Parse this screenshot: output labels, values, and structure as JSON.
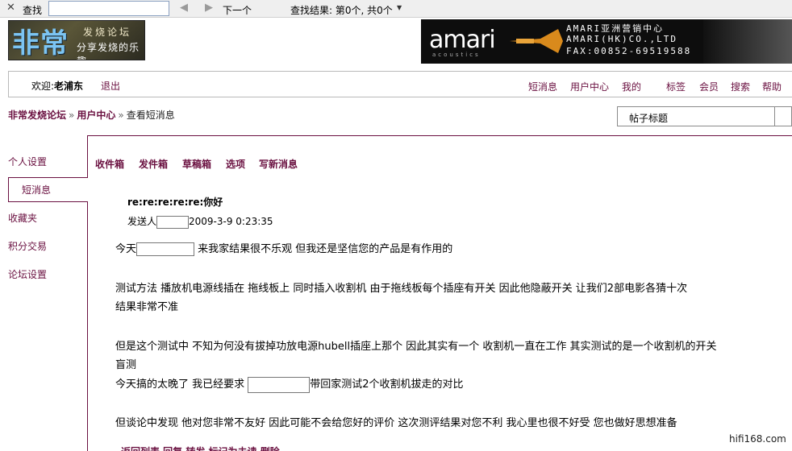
{
  "findbar": {
    "close_icon": "close-icon",
    "label": "查找",
    "input_value": "",
    "prev_icon": "arrow-left-icon",
    "next_icon": "arrow-right-icon",
    "next_label": "下一个",
    "result": "查找结果: 第0个, 共0个"
  },
  "logo": {
    "big": "非常",
    "s1": "发烧论坛",
    "s2": "分享发烧的乐趣"
  },
  "ad": {
    "brand": "amari",
    "brand_sub": "acoustics",
    "line1": "AMARI亚洲营销中心",
    "line2": "AMARI(HK)CO.,LTD",
    "line3": "FAX:00852-69519588"
  },
  "nav": {
    "welcome_prefix": "欢迎:",
    "username": "老浦东",
    "logout": "退出",
    "items": [
      "短消息",
      "用户中心",
      "我的",
      "标签",
      "会员",
      "搜索",
      "帮助"
    ]
  },
  "breadcrumb": {
    "forum": "非常发烧论坛",
    "user_center": "用户中心",
    "current": "查看短消息"
  },
  "search": {
    "label": "帖子标题"
  },
  "sidebar": {
    "items": [
      "个人设置",
      "短消息",
      "收藏夹",
      "积分交易",
      "论坛设置"
    ]
  },
  "tabs": [
    "收件箱",
    "发件箱",
    "草稿箱",
    "选项",
    "写新消息"
  ],
  "message": {
    "subject": "re:re:re:re:re:你好",
    "sender_label": "发送人",
    "datetime": "2009-3-9 0:23:35",
    "p1_pre": "今天",
    "p1_post": "来我家结果很不乐观  但我还是坚信您的产品是有作用的",
    "p2_l1": "测试方法  播放机电源线插在  拖线板上  同时插入收割机  由于拖线板每个插座有开关  因此他隐蔽开关  让我们2部电影各猜十次",
    "p2_l2": "结果非常不准",
    "p3_l1": "但是这个测试中  不知为何没有拔掉功放电源hubell插座上那个  因此其实有一个  收割机一直在工作  其实测试的是一个收割机的开关",
    "p3_l2": "盲测",
    "p4_pre": "今天搞的太晚了  我已经要求",
    "p4_post": "带回家测试2个收割机拔走的对比",
    "p5": "但谈论中发现  他对您非常不友好  因此可能不会给您好的评价  这次测评结果对您不利  我心里也很不好受  您也做好思想准备"
  },
  "actions": "返回列表  回复  转发  标记为未读  删除",
  "watermark": "hifi168.com"
}
